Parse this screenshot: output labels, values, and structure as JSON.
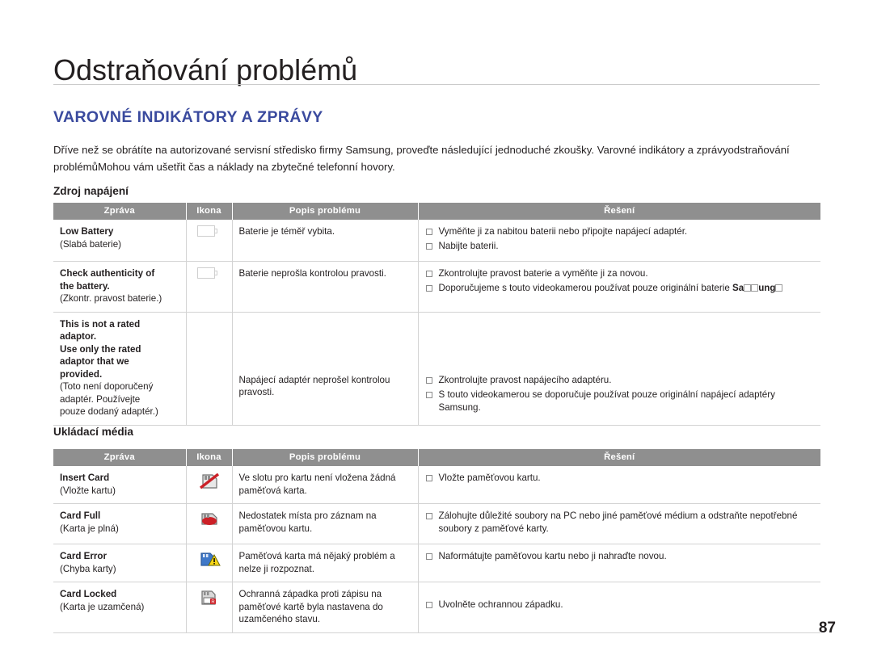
{
  "page": {
    "title": "Odstraňování problémů",
    "subtitle": "VAROVNÉ INDIKÁTORY A ZPRÁVY",
    "intro": "Dříve než se obrátíte na autorizované servisní středisko firmy Samsung, proveďte následující jednoduché zkoušky. Varovné indikátory a zprávyodstraňování problémůMohou vám ušetřit čas a náklady na zbytečné telefonní hovory.",
    "page_number": "87",
    "accent_color": "#3a4a9e",
    "header_bg": "#8f8f8f"
  },
  "sections": [
    {
      "heading": "Zdroj napájení",
      "columns": [
        "Zpráva",
        "Ikona",
        "Popis problému",
        "Řešení"
      ],
      "rows": [
        {
          "message_bold": "Low Battery",
          "message_note": "(Slabá baterie)",
          "icon": "battery-empty-icon",
          "problem": "Baterie je téměř vybita.",
          "solutions": [
            "Vyměňte ji za nabitou baterii nebo připojte napájecí adaptér.",
            "Nabijte baterii."
          ]
        },
        {
          "message_bold": "Check authenticity of\nthe battery.",
          "message_note": "(Zkontr. pravost baterie.)",
          "icon": "battery-check-icon",
          "problem": "Baterie neprošla kontrolou pravosti.",
          "solutions": [
            "Zkontrolujte pravost baterie a vyměňte ji za novou.",
            "Doporučujeme s touto videokamerou používat pouze originální baterie"
          ],
          "solution_extra": "Samsung."
        },
        {
          "message_bold": "This is not a rated\nadaptor.\nUse only the rated\nadaptor that we\nprovided.",
          "message_note": "(Toto není doporučený\nadaptér. Používejte\npouze dodaný adaptér.)",
          "icon": "none",
          "problem": "Napájecí adaptér neprošel kontrolou pravosti.",
          "solutions": [
            "Zkontrolujte pravost napájecího adaptéru.",
            "S touto videokamerou se doporučuje používat pouze originální napájecí adaptéry Samsung."
          ]
        }
      ]
    },
    {
      "heading": "Ukládací média",
      "columns": [
        "Zpráva",
        "Ikona",
        "Popis problému",
        "Řešení"
      ],
      "rows": [
        {
          "message_bold": "Insert Card",
          "message_note": "(Vložte kartu)",
          "icon": "card-insert-icon",
          "problem": "Ve slotu pro kartu není vložena žádná paměťová karta.",
          "solutions": [
            "Vložte paměťovou kartu."
          ]
        },
        {
          "message_bold": "Card Full",
          "message_note": "(Karta je plná)",
          "icon": "card-full-icon",
          "problem": "Nedostatek místa pro záznam na paměťovou kartu.",
          "solutions": [
            "Zálohujte důležité soubory na PC nebo jiné paměťové médium a odstraňte nepotřebné soubory z paměťové karty."
          ]
        },
        {
          "message_bold": "Card Error",
          "message_note": "(Chyba karty)",
          "icon": "card-error-icon",
          "problem": "Paměťová karta má nějaký problém a nelze ji rozpoznat.",
          "solutions": [
            "Naformátujte paměťovou kartu nebo ji nahraďte novou."
          ]
        },
        {
          "message_bold": "Card Locked",
          "message_note": "(Karta je uzamčená)",
          "icon": "card-locked-icon",
          "problem": "Ochranná západka proti zápisu na paměťové kartě byla nastavena do uzamčeného stavu.",
          "solutions": [
            "Uvolněte ochrannou západku."
          ]
        }
      ]
    }
  ]
}
